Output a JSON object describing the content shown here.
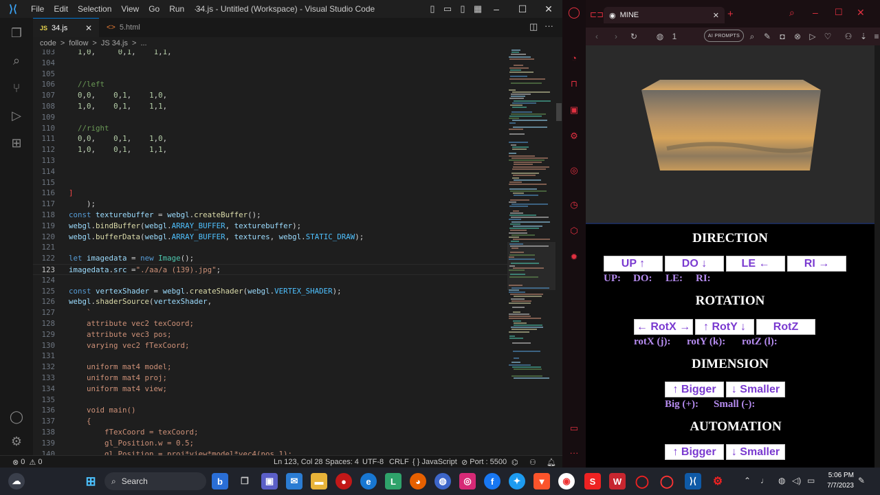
{
  "vscode": {
    "menu": [
      "File",
      "Edit",
      "Selection",
      "View",
      "Go",
      "Run",
      "···"
    ],
    "window_title": "34.js - Untitled (Workspace) - Visual Studio Code",
    "tabs": [
      {
        "label": "34.js",
        "icon": "JS"
      },
      {
        "label": "5.html",
        "icon": "<>"
      }
    ],
    "breadcrumb": [
      "code",
      ">",
      "follow",
      ">",
      "JS 34.js",
      ">",
      "..."
    ],
    "code_lines": [
      {
        "n": "103",
        "html": "<span class='num'>1</span>,<span class='num'>0</span>,     <span class='num'>0</span>,<span class='num'>1</span>,    <span class='num'>1</span>,<span class='num'>1</span>,",
        "indent": 2
      },
      {
        "n": "104",
        "html": "",
        "indent": 0
      },
      {
        "n": "105",
        "html": "",
        "indent": 0
      },
      {
        "n": "106",
        "html": "<span class='cm'>//left</span>",
        "indent": 2
      },
      {
        "n": "107",
        "html": "<span class='num'>0</span>,<span class='num'>0</span>,    <span class='num'>0</span>,<span class='num'>1</span>,    <span class='num'>1</span>,<span class='num'>0</span>,",
        "indent": 2
      },
      {
        "n": "108",
        "html": "<span class='num'>1</span>,<span class='num'>0</span>,    <span class='num'>0</span>,<span class='num'>1</span>,    <span class='num'>1</span>,<span class='num'>1</span>,",
        "indent": 2
      },
      {
        "n": "109",
        "html": "",
        "indent": 0
      },
      {
        "n": "110",
        "html": "<span class='cm'>//right</span>",
        "indent": 2
      },
      {
        "n": "111",
        "html": "<span class='num'>0</span>,<span class='num'>0</span>,    <span class='num'>0</span>,<span class='num'>1</span>,    <span class='num'>1</span>,<span class='num'>0</span>,",
        "indent": 2
      },
      {
        "n": "112",
        "html": "<span class='num'>1</span>,<span class='num'>0</span>,    <span class='num'>0</span>,<span class='num'>1</span>,    <span class='num'>1</span>,<span class='num'>1</span>,",
        "indent": 2
      },
      {
        "n": "113",
        "html": "",
        "indent": 0
      },
      {
        "n": "114",
        "html": "",
        "indent": 0
      },
      {
        "n": "115",
        "html": "",
        "indent": 0
      },
      {
        "n": "116",
        "html": "<span class='bracket-red'>]</span>",
        "indent": 0
      },
      {
        "n": "117",
        "html": "    );",
        "indent": 0
      },
      {
        "n": "118",
        "html": "<span class='kw'>const</span> <span class='var'>texturebuffer</span> = <span class='var'>webgl</span>.<span class='fn'>createBuffer</span>();",
        "indent": 0
      },
      {
        "n": "119",
        "html": "<span class='var'>webgl</span>.<span class='fn'>bindBuffer</span>(<span class='var'>webgl</span>.<span class='cst'>ARRAY_BUFFER</span>, <span class='var'>texturebuffer</span>);",
        "indent": 0
      },
      {
        "n": "120",
        "html": "<span class='var'>webgl</span>.<span class='fn'>bufferData</span>(<span class='var'>webgl</span>.<span class='cst'>ARRAY_BUFFER</span>, <span class='var'>textures</span>, <span class='var'>webgl</span>.<span class='cst'>STATIC_DRAW</span>);",
        "indent": 0
      },
      {
        "n": "121",
        "html": "",
        "indent": 0
      },
      {
        "n": "122",
        "html": "<span class='kw'>let</span> <span class='var'>imagedata</span> = <span class='kw'>new</span> <span class='ty'>Image</span>();",
        "indent": 0
      },
      {
        "n": "123",
        "html": "<span class='var'>imagedata</span>.<span class='var'>src</span> =<span class='str'>\"./aa/a (139).jpg\"</span>;",
        "indent": 0
      },
      {
        "n": "124",
        "html": "",
        "indent": 0
      },
      {
        "n": "125",
        "html": "<span class='kw'>const</span> <span class='var'>vertexShader</span> = <span class='var'>webgl</span>.<span class='fn'>createShader</span>(<span class='var'>webgl</span>.<span class='cst'>VERTEX_SHADER</span>);",
        "indent": 0
      },
      {
        "n": "126",
        "html": "<span class='var'>webgl</span>.<span class='fn'>shaderSource</span>(<span class='var'>vertexShader</span>,",
        "indent": 0
      },
      {
        "n": "127",
        "html": "    <span class='str'>`</span>",
        "indent": 0
      },
      {
        "n": "128",
        "html": "<span class='str'>attribute vec2 texCoord;</span>",
        "indent": 4
      },
      {
        "n": "129",
        "html": "<span class='str'>attribute vec3 pos;</span>",
        "indent": 4
      },
      {
        "n": "130",
        "html": "<span class='str'>varying vec2 fTexCoord;</span>",
        "indent": 4
      },
      {
        "n": "131",
        "html": "",
        "indent": 0
      },
      {
        "n": "132",
        "html": "<span class='str'>uniform mat4 model;</span>",
        "indent": 4
      },
      {
        "n": "133",
        "html": "<span class='str'>uniform mat4 proj;</span>",
        "indent": 4
      },
      {
        "n": "134",
        "html": "<span class='str'>uniform mat4 view;</span>",
        "indent": 4
      },
      {
        "n": "135",
        "html": "",
        "indent": 0
      },
      {
        "n": "136",
        "html": "<span class='str'>void main()</span>",
        "indent": 4
      },
      {
        "n": "137",
        "html": "<span class='str'>{</span>",
        "indent": 4
      },
      {
        "n": "138",
        "html": "<span class='str'>fTexCoord = texCoord;</span>",
        "indent": 8
      },
      {
        "n": "139",
        "html": "<span class='str'>gl_Position.w = 0.5;</span>",
        "indent": 8
      },
      {
        "n": "140",
        "html": "<span class='str'>gl_Position = proj*view*model*vec4(pos,1);</span>",
        "indent": 8
      }
    ],
    "status": {
      "errors": "0",
      "warnings": "0",
      "cursor": "Ln 123, Col 28",
      "spaces": "Spaces: 4",
      "encoding": "UTF-8",
      "eol": "CRLF",
      "language": "{ } JavaScript",
      "port": "Port : 5500"
    }
  },
  "browser": {
    "tab_title": "MINE",
    "toolbar": {
      "counter": "1",
      "ai_prompts": "AI PROMPTS"
    },
    "page": {
      "direction_title": "DIRECTION",
      "direction_buttons": [
        "UP ↑",
        "DO ↓",
        "LE ←",
        "RI →"
      ],
      "direction_labels": [
        "UP:",
        "DO:",
        "LE:",
        "RI:"
      ],
      "rotation_title": "ROTATION",
      "rotation_buttons": [
        "← RotX →",
        "↑ RotY ↓",
        "RotZ"
      ],
      "rotation_labels": [
        "rotX (j):",
        "rotY (k):",
        "rotZ (l):"
      ],
      "dimension_title": "DIMENSION",
      "dimension_buttons": [
        "↑ Bigger",
        "↓ Smaller"
      ],
      "dimension_labels": [
        "Big (+):",
        "Small (-):"
      ],
      "automation_title": "AUTOMATION",
      "automation_buttons": [
        "↑ Bigger",
        "↓ Smaller"
      ]
    }
  },
  "taskbar": {
    "search_label": "Search",
    "time": "5:06 PM",
    "date": "7/7/2023"
  }
}
